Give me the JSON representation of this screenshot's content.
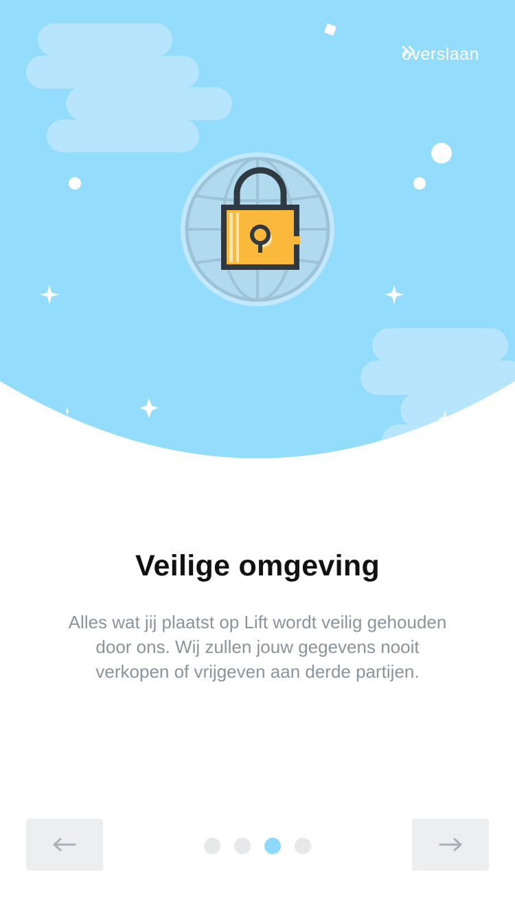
{
  "header": {
    "skip_label": "overslaan",
    "skip_icon": "double-chevron-right-icon"
  },
  "illustration": {
    "icon": "padlock-globe-icon",
    "sky_color": "#93dcfc",
    "cloud_color": "#b6e5fd",
    "lock_color": "#fbb93c"
  },
  "content": {
    "title": "Veilige omgeving",
    "body_lines": [
      "Alles wat jij plaatst op Lift wordt veilig gehouden",
      "door ons. Wij zullen jouw gegevens nooit",
      "verkopen of vrijgeven aan derde partijen."
    ]
  },
  "pager": {
    "total": 4,
    "current": 3,
    "active_color": "#8fd9fb",
    "inactive_color": "#e6e8ea"
  },
  "navigation": {
    "prev_icon": "arrow-left-icon",
    "next_icon": "arrow-right-icon"
  }
}
